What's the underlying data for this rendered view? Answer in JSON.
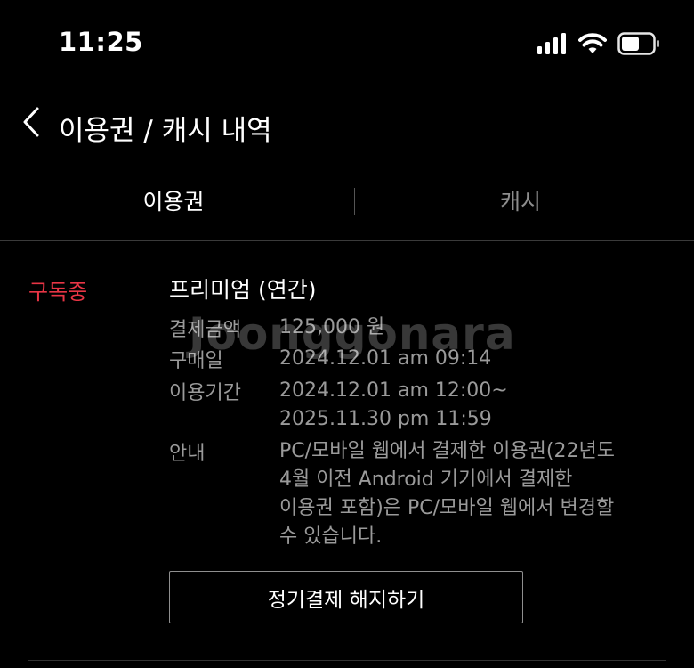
{
  "status_bar": {
    "time": "11:25",
    "icons": [
      "signal-icon",
      "wifi-icon",
      "battery-icon"
    ]
  },
  "header": {
    "back_icon": "chevron-left-icon",
    "title": "이용권 / 캐시 내역"
  },
  "tabs": [
    {
      "label": "이용권",
      "active": true
    },
    {
      "label": "캐시",
      "active": false
    }
  ],
  "subscription": {
    "status": "구독중",
    "status_color": "#e83545",
    "plan": "프리미엄 (연간)",
    "details": [
      {
        "key": "결제금액",
        "lines": [
          "125,000 원"
        ]
      },
      {
        "key": "구매일",
        "lines": [
          "2024.12.01 am 09:14"
        ]
      },
      {
        "key": "이용기간",
        "lines": [
          "2024.12.01 am 12:00~",
          "2025.11.30 pm 11:59"
        ]
      },
      {
        "key": "안내",
        "lines": [
          "PC/모바일 웹에서 결제한 이용권(22년도",
          "4월 이전 Android 기기에서 결제한",
          "이용권 포함)은 PC/모바일 웹에서 변경할",
          "수 있습니다."
        ]
      }
    ],
    "cancel_button": "정기결제 해지하기"
  },
  "watermark": "Joonggonara"
}
